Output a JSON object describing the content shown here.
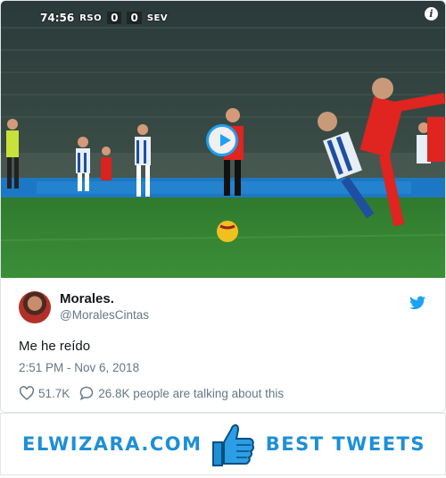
{
  "video": {
    "clock": "74:56",
    "home_team": "RSO",
    "home_score": "0",
    "away_score": "0",
    "away_team": "SEV",
    "info_icon": "info-icon",
    "play_icon": "play-icon"
  },
  "tweet": {
    "display_name": "Morales.",
    "handle": "@MoralesCintas",
    "text": "Me he reído",
    "timestamp": "2:51 PM - Nov 6, 2018",
    "likes": "51.7K",
    "talking": "26.8K people are talking about this",
    "brand_icon": "twitter-bird-icon"
  },
  "banner": {
    "left_text": "ELWIZARA.COM",
    "right_text": "BEST TWEETS",
    "icon": "thumbs-up-icon"
  },
  "colors": {
    "accent": "#1da1f2",
    "banner_blue": "#1e8fd6",
    "text_primary": "#14171a",
    "text_secondary": "#657786"
  }
}
